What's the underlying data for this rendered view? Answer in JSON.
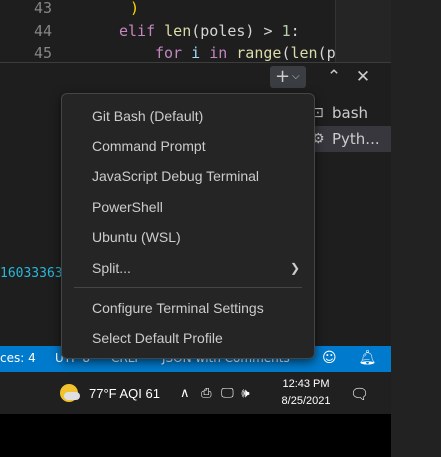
{
  "editor": {
    "lines": [
      {
        "num": "43",
        "code": ")"
      },
      {
        "num": "44",
        "code": "elif len(poles) > 1:"
      },
      {
        "num": "45",
        "code": "for i in range(len(p..."
      }
    ]
  },
  "panel": {
    "terminals": [
      {
        "label": "bash",
        "icon": "terminal-icon"
      },
      {
        "label": "Pyth...",
        "icon": "debug-gear-icon"
      }
    ],
    "partial_output": "16033363"
  },
  "statusbar": {
    "spaces": "ces: 4",
    "encoding": "UTF-8",
    "eol": "CRLF",
    "language": "JSON with Comments",
    "color": "#007acc"
  },
  "menu": {
    "items": [
      {
        "label": "Git Bash (Default)"
      },
      {
        "label": "Command Prompt"
      },
      {
        "label": "JavaScript Debug Terminal"
      },
      {
        "label": "PowerShell"
      },
      {
        "label": "Ubuntu (WSL)"
      },
      {
        "label": "Split..."
      }
    ],
    "settings_items": [
      {
        "label": "Configure Terminal Settings"
      },
      {
        "label": "Select Default Profile"
      }
    ]
  },
  "taskbar": {
    "weather": "77°F  AQI 61",
    "time": "12:43 PM",
    "date": "8/25/2021"
  }
}
